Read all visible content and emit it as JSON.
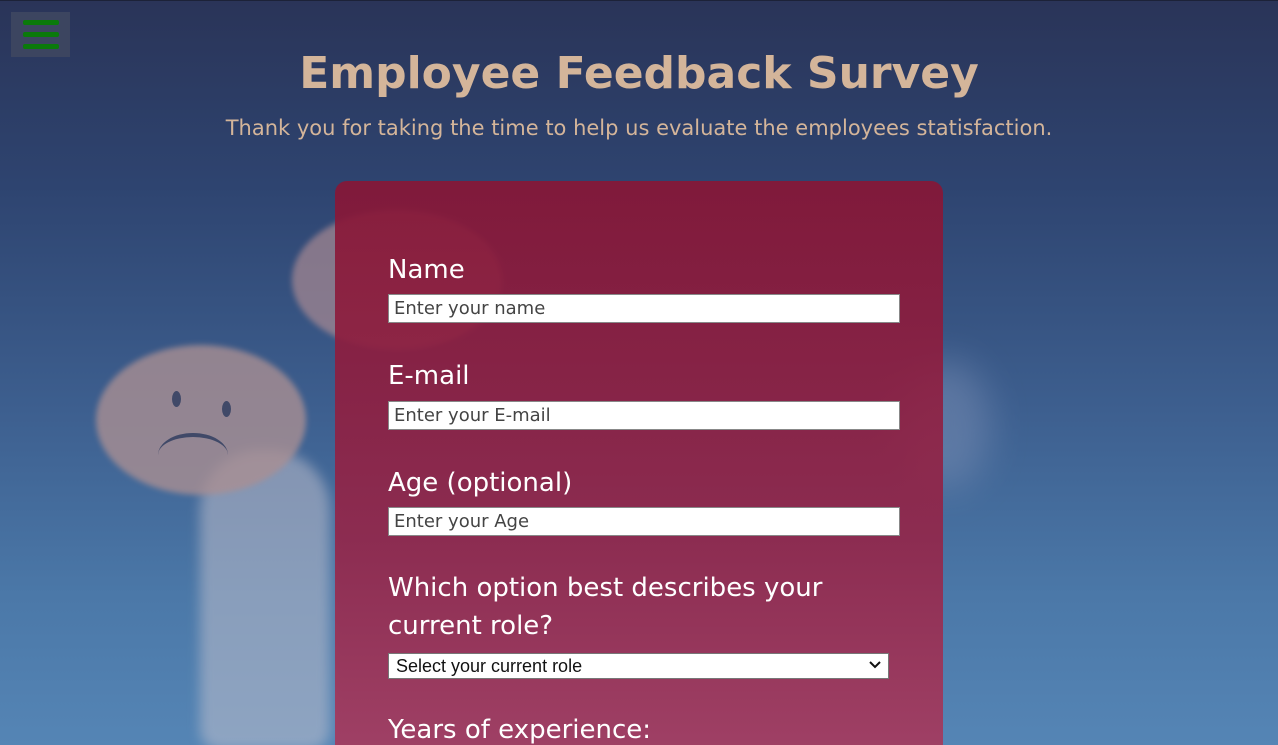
{
  "menu": {
    "icon": "hamburger-menu-icon",
    "color": "#0b7a0b"
  },
  "header": {
    "title": "Employee Feedback Survey",
    "subtitle": "Thank you for taking the time to help us evaluate the employees statisfaction."
  },
  "form": {
    "name": {
      "label": "Name",
      "placeholder": "Enter your name"
    },
    "email": {
      "label": "E-mail",
      "placeholder": "Enter your E-mail"
    },
    "age": {
      "label": "Age (optional)",
      "placeholder": "Enter your Age"
    },
    "role": {
      "label": "Which option best describes your current role?",
      "selected": "Select your current role"
    },
    "experience": {
      "label": "Years of experience:"
    }
  },
  "colors": {
    "title": "#d4b59a",
    "card": "#871636",
    "background": "#2e4470"
  }
}
